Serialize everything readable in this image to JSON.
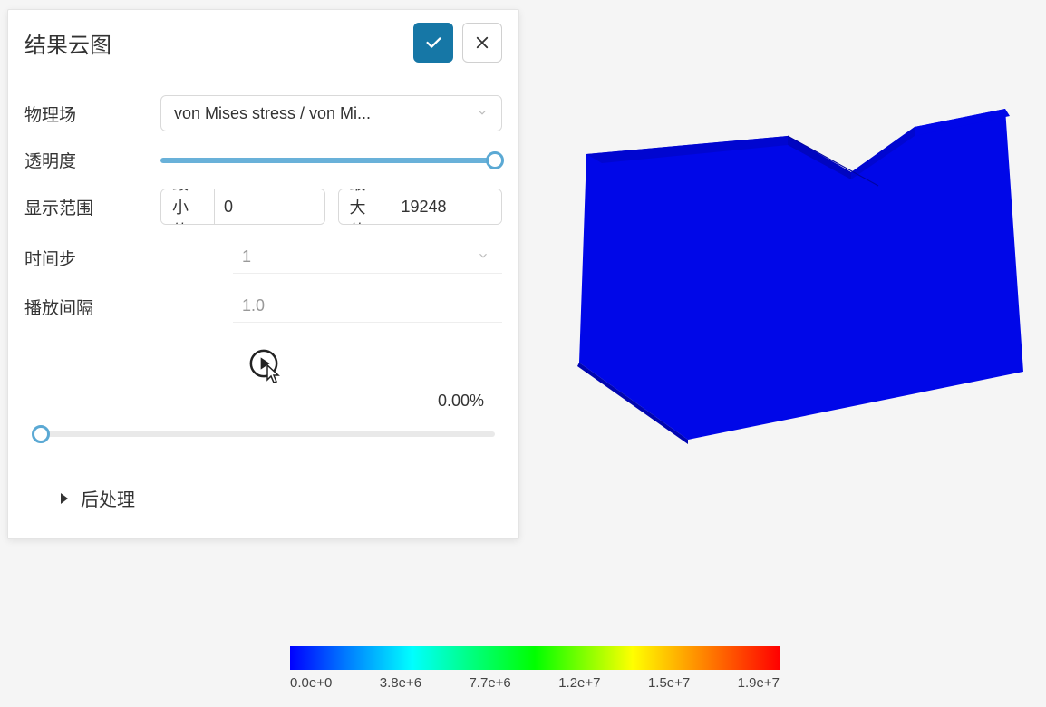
{
  "panel": {
    "title": "结果云图",
    "field_label": "物理场",
    "field_value": "von Mises stress / von Mi...",
    "opacity_label": "透明度",
    "range_label": "显示范围",
    "range_min_label": "最小值",
    "range_min_value": "0",
    "range_max_label": "最大值",
    "range_max_value": "19248",
    "timestep_label": "时间步",
    "timestep_value": "1",
    "interval_label": "播放间隔",
    "interval_value": "1.0",
    "progress_pct": "0.00%",
    "section_post": "后处理"
  },
  "legend": {
    "ticks": [
      "0.0e+0",
      "3.8e+6",
      "7.7e+6",
      "1.2e+7",
      "1.5e+7",
      "1.9e+7"
    ]
  }
}
